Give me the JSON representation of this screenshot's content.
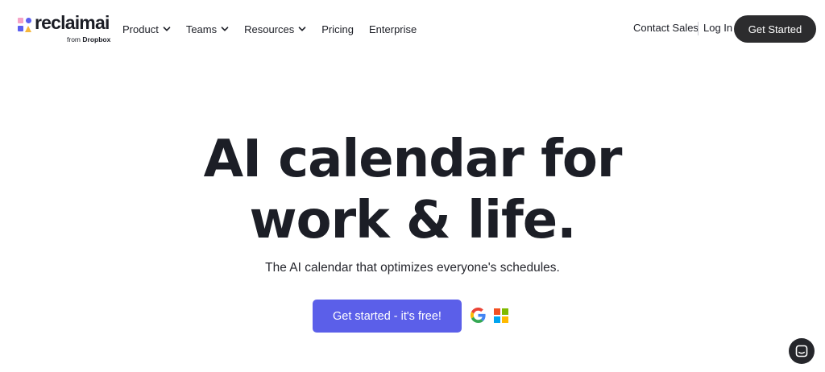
{
  "brand": {
    "name": "reclaimai",
    "sub_prefix": "from",
    "sub_brand": "Dropbox",
    "colors": {
      "pink": "#f5a3c7",
      "indigo": "#5b5fef",
      "yellow": "#f6b73c"
    }
  },
  "nav": {
    "items": [
      {
        "label": "Product",
        "has_dropdown": true
      },
      {
        "label": "Teams",
        "has_dropdown": true
      },
      {
        "label": "Resources",
        "has_dropdown": true
      },
      {
        "label": "Pricing",
        "has_dropdown": false
      },
      {
        "label": "Enterprise",
        "has_dropdown": false
      }
    ],
    "contact_sales": "Contact Sales",
    "log_in": "Log In",
    "get_started": "Get Started"
  },
  "hero": {
    "title_line1": "AI calendar for",
    "title_line2": "work & life.",
    "subtitle": "The AI calendar that optimizes everyone's schedules.",
    "cta_label": "Get started - it's free!",
    "cta_color": "#5b5fe9",
    "providers": [
      "google-icon",
      "microsoft-icon"
    ]
  },
  "support": {
    "icon": "chat-icon"
  }
}
